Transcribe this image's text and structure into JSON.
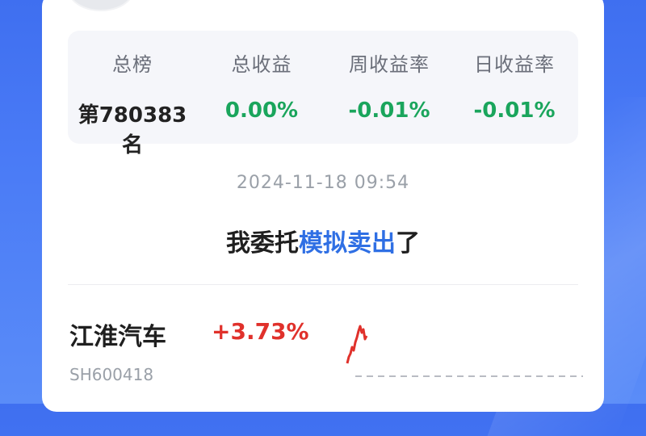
{
  "stats": {
    "items": [
      {
        "label": "总榜",
        "value": "第780383名"
      },
      {
        "label": "总收益",
        "value": "0.00%"
      },
      {
        "label": "周收益率",
        "value": "-0.01%"
      },
      {
        "label": "日收益率",
        "value": "-0.01%"
      }
    ]
  },
  "post": {
    "timestamp": "2024-11-18 09:54",
    "action_prefix": "我委托",
    "action_link": "模拟卖出",
    "action_suffix": "了"
  },
  "stock": {
    "name": "江淮汽车",
    "change": "+3.73%",
    "code": "SH600418"
  },
  "colors": {
    "background": "#4a7bf6",
    "positive": "#e0312b",
    "gain_green": "#1aa55c",
    "link": "#2f6fe4"
  }
}
